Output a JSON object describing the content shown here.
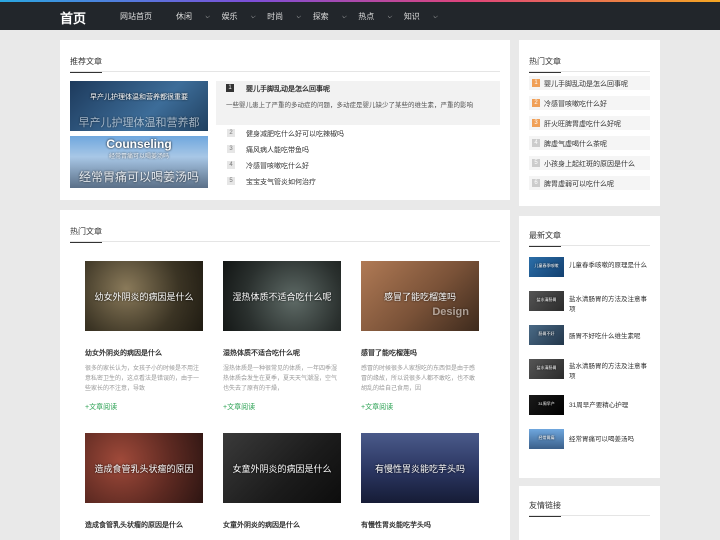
{
  "nav": {
    "logo": "首页",
    "items": [
      {
        "label": "网站首页",
        "caret": false,
        "active": true
      },
      {
        "label": "休闲",
        "caret": true,
        "active": false
      },
      {
        "label": "娱乐",
        "caret": true,
        "active": false
      },
      {
        "label": "时尚",
        "caret": true,
        "active": false
      },
      {
        "label": "探索",
        "caret": true,
        "active": false
      },
      {
        "label": "热点",
        "caret": true,
        "active": false
      },
      {
        "label": "知识",
        "caret": true,
        "active": false
      }
    ]
  },
  "recommend": {
    "title": "推荐文章",
    "thumbs": [
      {
        "small": "早产儿护理体温和营养都很重要",
        "big": "早产儿护理体温和营养都"
      },
      {
        "small": "Counseling",
        "sub": "经常胃痛可以喝姜汤吗",
        "big": "经常胃痛可以喝姜汤吗"
      }
    ],
    "featured": {
      "num": "1",
      "title": "婴儿手脚乱动是怎么回事呢",
      "summary": "一些婴儿患上了严重的多动症的问题，多动症是婴儿缺少了某些的维生素，严重的影响"
    },
    "list": [
      {
        "num": "2",
        "title": "健身减肥吃什么好可以吃辣椒吗"
      },
      {
        "num": "3",
        "title": "痛风病人能吃带鱼吗"
      },
      {
        "num": "4",
        "title": "冷感冒咳嗽吃什么好"
      },
      {
        "num": "5",
        "title": "宝宝支气管炎如何治疗"
      }
    ]
  },
  "hot_side": {
    "title": "热门文章",
    "items": [
      {
        "num": "1",
        "title": "婴儿手脚乱动是怎么回事呢"
      },
      {
        "num": "2",
        "title": "冷感冒咳嗽吃什么好"
      },
      {
        "num": "3",
        "title": "肝火旺脾胃虚吃什么好呢"
      },
      {
        "num": "4",
        "title": "脾虚气虚喝什么茶呢"
      },
      {
        "num": "5",
        "title": "小孩身上起红斑的原因是什么"
      },
      {
        "num": "6",
        "title": "脾胃虚弱可以吃什么呢"
      }
    ]
  },
  "hot_main": {
    "title": "热门文章",
    "more_label": "+文章阅读",
    "cards": [
      {
        "img": "幼女外阴炎的病因是什么",
        "title": "幼女外阴炎的病因是什么",
        "summary": "很多的家长认为，女孩子小的时候是不用注意私密卫生的，这点看法是错误的，由于一些家长的不注意，导致"
      },
      {
        "img": "湿热体质不适合吃什么呢",
        "title": "湿热体质不适合吃什么呢",
        "summary": "湿热体质是一种很常见的体质，一年四季湿热体质会发生在夏季，夏天天气潮湿，空气也失去了原有的干燥，"
      },
      {
        "img": "感冒了能吃榴莲吗",
        "img_sub": "Design",
        "title": "感冒了能吃榴莲吗",
        "summary": "感冒的时候很多人家想吃的东西但是由于感冒的缘故，所以说很多人都不敢吃，也不敢胡乱的给自己食用，因"
      },
      {
        "img": "造成食管乳头状瘤的原因",
        "title": "造成食管乳头状瘤的原因是什么",
        "summary": ""
      },
      {
        "img": "女童外阴炎的病因是什么",
        "title": "女童外阴炎的病因是什么",
        "summary": ""
      },
      {
        "img": "有慢性胃炎能吃芋头吗",
        "title": "有慢性胃炎能吃芋头吗",
        "summary": ""
      }
    ]
  },
  "latest": {
    "title": "最新文章",
    "items": [
      {
        "title": "儿童春季咳嗽的原理是什么",
        "img": "儿童春季咳嗽"
      },
      {
        "title": "盐水清肠胃的方法及注意事项",
        "img": "盐水清肠胃"
      },
      {
        "title": "肠胃不好吃什么维生素呢",
        "img": "肠胃不好"
      },
      {
        "title": "盐水清肠胃的方法及注意事项",
        "img": "盐水清肠胃"
      },
      {
        "title": "31周早产要精心护理",
        "img": "31周早产"
      },
      {
        "title": "经常胃痛可以喝姜汤吗",
        "img": "经常胃痛"
      }
    ]
  },
  "links": {
    "title": "友情链接"
  }
}
